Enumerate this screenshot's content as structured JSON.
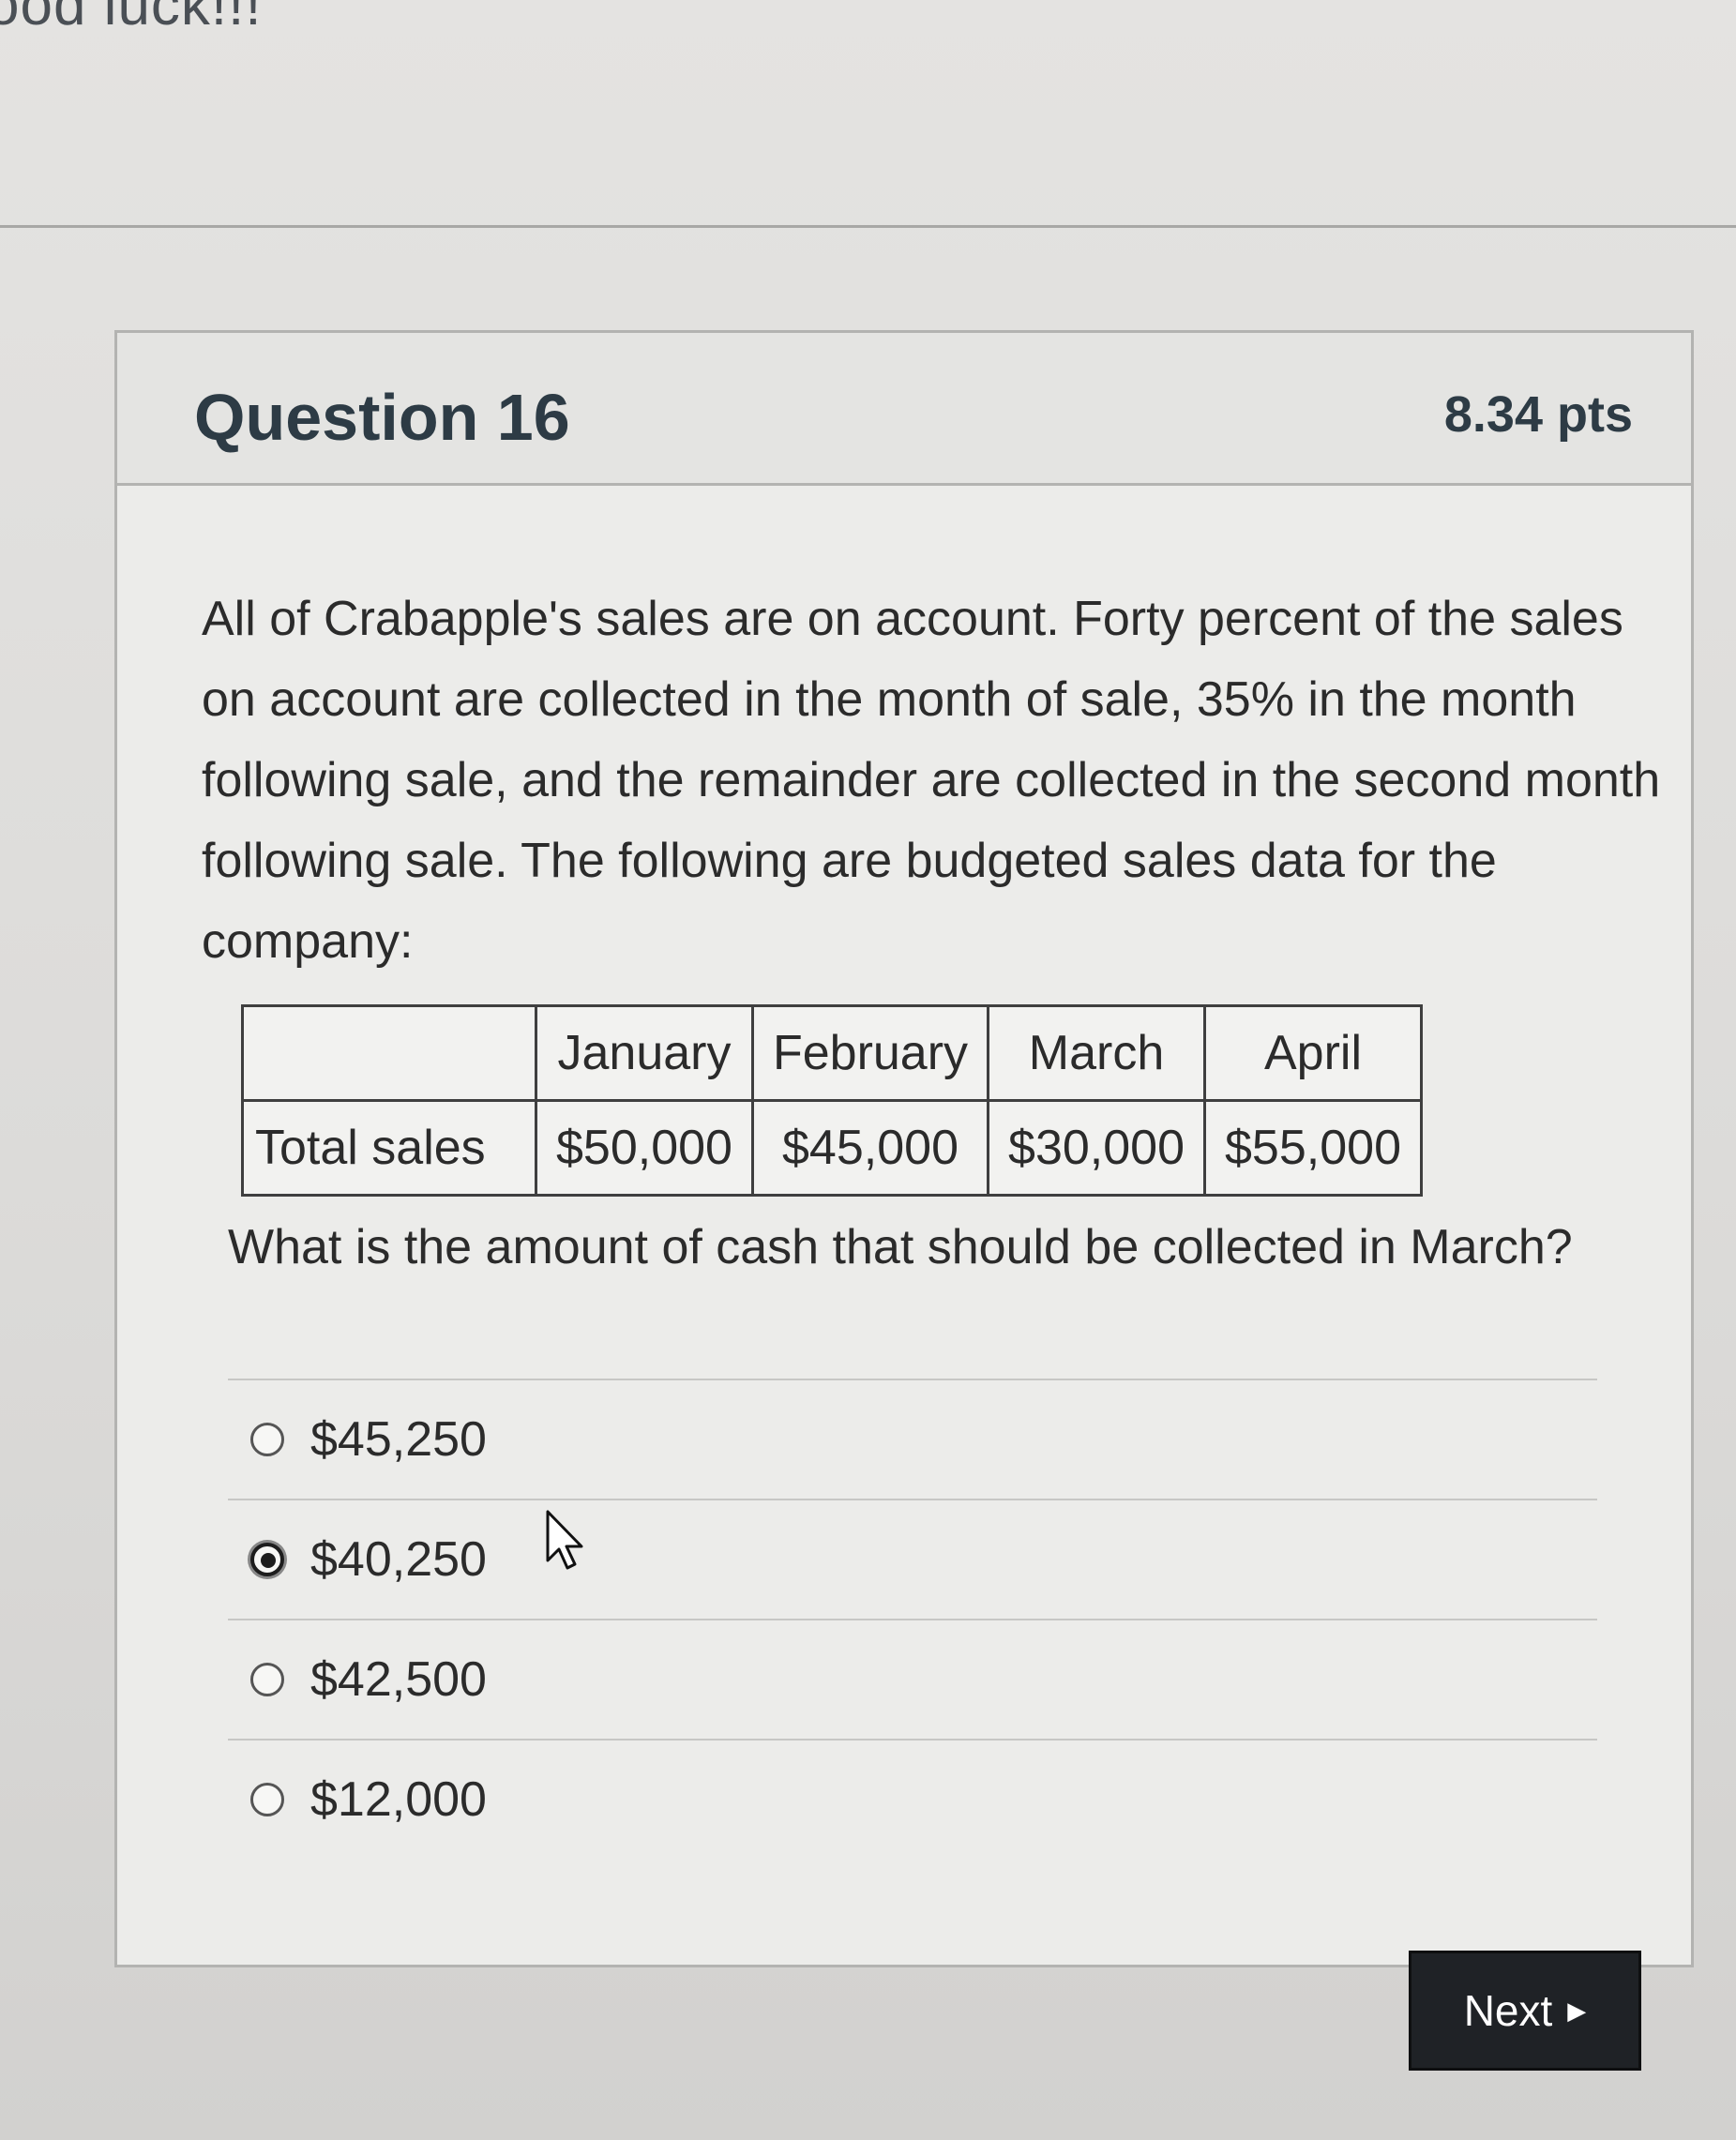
{
  "page": {
    "top_note": "ood luck!!!"
  },
  "question": {
    "title": "Question 16",
    "points": "8.34 pts",
    "body": "All of Crabapple's sales are on account. Forty percent of the sales on account are collected in the month of sale, 35% in the month following sale, and the remainder are collected in the second month following sale. The following are budgeted sales data for the company:",
    "table": {
      "headers": [
        "",
        "January",
        "February",
        "March",
        "April"
      ],
      "row_label": "Total sales",
      "values": [
        "$50,000",
        "$45,000",
        "$30,000",
        "$55,000"
      ]
    },
    "prompt": "What is the amount of cash that should be collected in March?",
    "options": [
      {
        "label": "$45,250",
        "selected": false
      },
      {
        "label": "$40,250",
        "selected": true
      },
      {
        "label": "$42,500",
        "selected": false
      },
      {
        "label": "$12,000",
        "selected": false
      }
    ]
  },
  "navigation": {
    "next_label": "Next",
    "next_icon": "triangle-right-icon"
  }
}
